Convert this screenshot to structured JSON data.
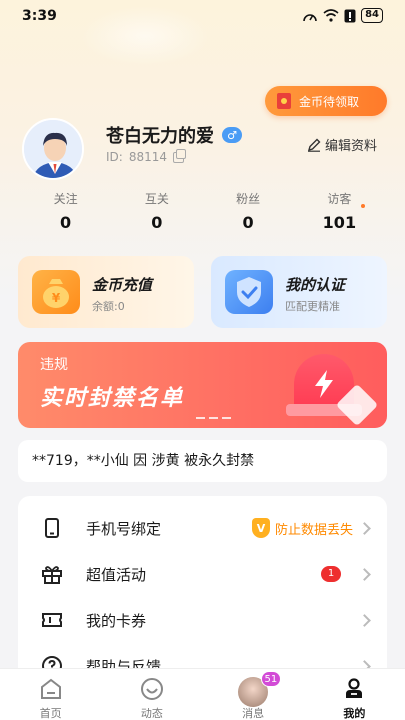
{
  "status_bar": {
    "time": "3:39",
    "battery": "84"
  },
  "coin_pending": {
    "label": "金币待领取"
  },
  "profile": {
    "name": "苍白无力的爱",
    "gender_symbol": "♂",
    "id_label": "ID:",
    "id_value": "88114",
    "edit_label": "编辑资料"
  },
  "stats": [
    {
      "label": "关注",
      "value": "0"
    },
    {
      "label": "互关",
      "value": "0"
    },
    {
      "label": "粉丝",
      "value": "0"
    },
    {
      "label": "访客",
      "value": "101"
    }
  ],
  "cards": {
    "recharge": {
      "title": "金币充值",
      "subtitle": "余额:0"
    },
    "auth": {
      "title": "我的认证",
      "subtitle": "匹配更精准"
    }
  },
  "ban_banner": {
    "small": "违规",
    "big": "实时封禁名单"
  },
  "ticker": {
    "text": "**719，**小仙 因 涉黄 被永久封禁"
  },
  "menu": {
    "items": [
      {
        "label": "手机号绑定",
        "extra": "防止数据丢失",
        "extra_badge": "V"
      },
      {
        "label": "超值活动",
        "count": "1"
      },
      {
        "label": "我的卡券"
      },
      {
        "label": "帮助与反馈"
      }
    ]
  },
  "tabbar": {
    "items": [
      {
        "label": "首页"
      },
      {
        "label": "动态"
      },
      {
        "label": "消息",
        "badge": "51"
      },
      {
        "label": "我的"
      }
    ]
  },
  "colors": {
    "accent_orange": "#ff7a2a",
    "banner_red": "#ff6e63",
    "badge_red": "#ee2f2f"
  }
}
